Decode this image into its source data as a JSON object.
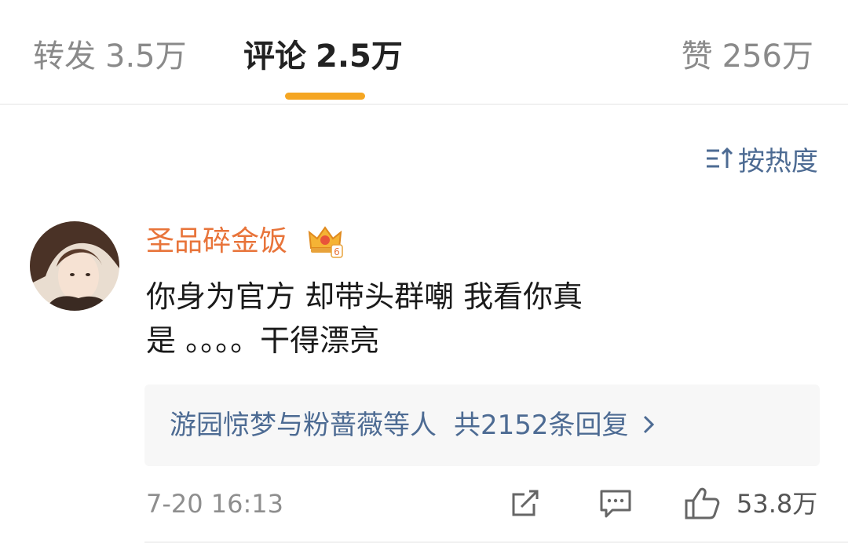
{
  "tabs": {
    "forward": {
      "label": "转发",
      "count": "3.5万"
    },
    "comments": {
      "label": "评论",
      "count": "2.5万"
    },
    "likes": {
      "label": "赞",
      "count": "256万"
    }
  },
  "sort": {
    "label": "按热度",
    "icon": "sort-icon"
  },
  "comment": {
    "username": "圣品碎金饭",
    "badge_icon": "crown-vip-icon",
    "badge_level": "6",
    "text_line1": "你身为官方 却带头群嘲 我看你真",
    "text_line2": "是 。。。。干得漂亮",
    "replies": {
      "users": "游园惊梦与粉蔷薇",
      "suffix": "等人",
      "total": "共2152条回复"
    },
    "time": "7-20 16:13",
    "like_count": "53.8万"
  },
  "colors": {
    "accent": "#f5a623",
    "username": "#e8743a",
    "link": "#4d6b93"
  }
}
